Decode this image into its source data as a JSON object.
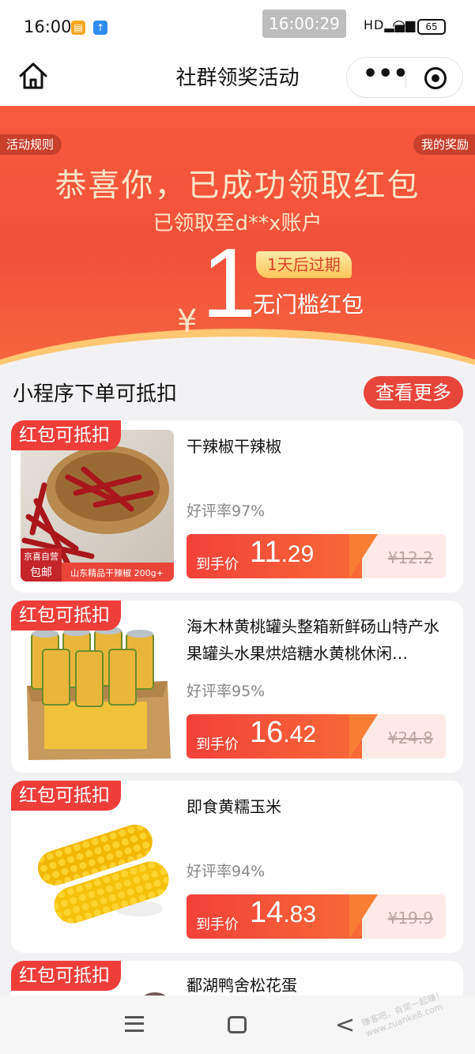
{
  "status_bar": {
    "time": "16:00",
    "clock_overlay": "16:00:29",
    "signal_label": "HD",
    "battery": "65"
  },
  "nav": {
    "title": "社群领奖活动",
    "more_glyph": "•••"
  },
  "banner": {
    "rules_label": "活动规则",
    "my_prizes_label": "我的奖励",
    "title": "恭喜你，已成功领取红包",
    "subtitle": "已领取至d**x账户",
    "currency": "¥",
    "amount": "1",
    "expire": "1天后过期",
    "coupon_label": "无门槛红包"
  },
  "section": {
    "title": "小程序下单可抵扣",
    "more_label": "查看更多"
  },
  "products": [
    {
      "badge": "红包可抵扣",
      "name": "干辣椒干辣椒",
      "rating": "好评率97%",
      "price_label": "到手价",
      "price_int": "11",
      "price_dec": ".29",
      "original_price": "¥12.2",
      "image_caption": "山东精品干辣椒 200g+",
      "image_tag_top": "京喜自营",
      "image_tag": "包邮"
    },
    {
      "badge": "红包可抵扣",
      "name": "海木林黄桃罐头整箱新鲜砀山特产水果罐头水果烘焙糖水黄桃休闲…",
      "rating": "好评率95%",
      "price_label": "到手价",
      "price_int": "16",
      "price_dec": ".42",
      "original_price": "¥24.8"
    },
    {
      "badge": "红包可抵扣",
      "name": "即食黄糯玉米",
      "rating": "好评率94%",
      "price_label": "到手价",
      "price_int": "14",
      "price_dec": ".83",
      "original_price": "¥19.9"
    },
    {
      "badge": "红包可抵扣",
      "name": "鄱湖鸭舍松花蛋"
    }
  ],
  "watermark": "赚客吧，有奖一起赚！www.zuanke8.com",
  "colors": {
    "accent_red": "#ee3e3a",
    "banner_red": "#f65a3d",
    "gold": "#ffc55b"
  }
}
